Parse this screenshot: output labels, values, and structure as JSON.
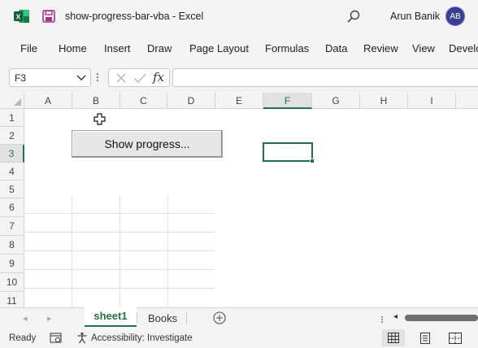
{
  "titlebar": {
    "doc_name": "show-progress-bar-vba",
    "separator": "-",
    "app_name": "Excel",
    "user_name": "Arun Banik",
    "user_initials": "AB"
  },
  "ribbon": {
    "tabs": [
      "File",
      "Home",
      "Insert",
      "Draw",
      "Page Layout",
      "Formulas",
      "Data",
      "Review",
      "View",
      "Develo"
    ]
  },
  "formula_bar": {
    "name_box": "F3",
    "fx_label": "fx",
    "formula": ""
  },
  "grid": {
    "columns": [
      "A",
      "B",
      "C",
      "D",
      "E",
      "F",
      "G",
      "H",
      "I"
    ],
    "rows": [
      "1",
      "2",
      "3",
      "4",
      "5",
      "6",
      "7",
      "8",
      "9",
      "10",
      "11"
    ],
    "active_column": "F",
    "active_row": "3",
    "button_label": "Show progress..."
  },
  "sheet_tabs": {
    "nav_prev": "◂",
    "nav_next": "▸",
    "tabs": [
      "sheet1",
      "Books"
    ],
    "active_tab": "sheet1",
    "scroll_left": "◂"
  },
  "statusbar": {
    "ready": "Ready",
    "accessibility": "Accessibility: Investigate"
  },
  "colors": {
    "accent": "#217346",
    "avatar": "#3b3f8f",
    "excel_green": "#1e7145"
  }
}
